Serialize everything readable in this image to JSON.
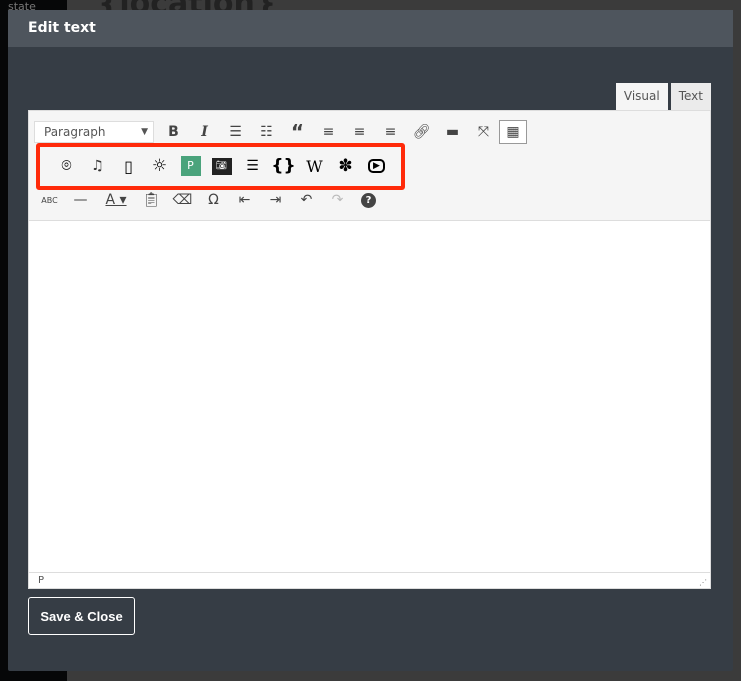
{
  "background": {
    "side_text": "state",
    "heading": "{location}"
  },
  "modal": {
    "title": "Edit text",
    "save_label": "Save & Close"
  },
  "editor": {
    "tabs": [
      {
        "label": "Visual",
        "active": true
      },
      {
        "label": "Text",
        "active": false
      }
    ],
    "format_select": "Paragraph",
    "row1": [
      "bold-icon",
      "italic-icon",
      "bullet-list-icon",
      "numbered-list-icon",
      "blockquote-icon",
      "align-left-icon",
      "align-center-icon",
      "align-right-icon",
      "link-icon",
      "read-more-icon",
      "fullscreen-icon",
      "toolbar-toggle-icon"
    ],
    "row2": [
      "location-pin-icon",
      "photo-audio-icon",
      "map-icon",
      "weather-sun-icon",
      "green-p-icon",
      "pixabay-icon",
      "list-icon",
      "braces-icon",
      "wikipedia-icon",
      "yelp-icon",
      "youtube-icon"
    ],
    "row3": [
      "strikethrough-icon",
      "horizontal-line-icon",
      "text-color-icon",
      "paste-text-icon",
      "clear-formatting-icon",
      "special-character-icon",
      "outdent-icon",
      "indent-icon",
      "undo-icon",
      "redo-icon",
      "help-icon"
    ],
    "highlight_color": "#ff2a0a",
    "status_path": "P"
  }
}
